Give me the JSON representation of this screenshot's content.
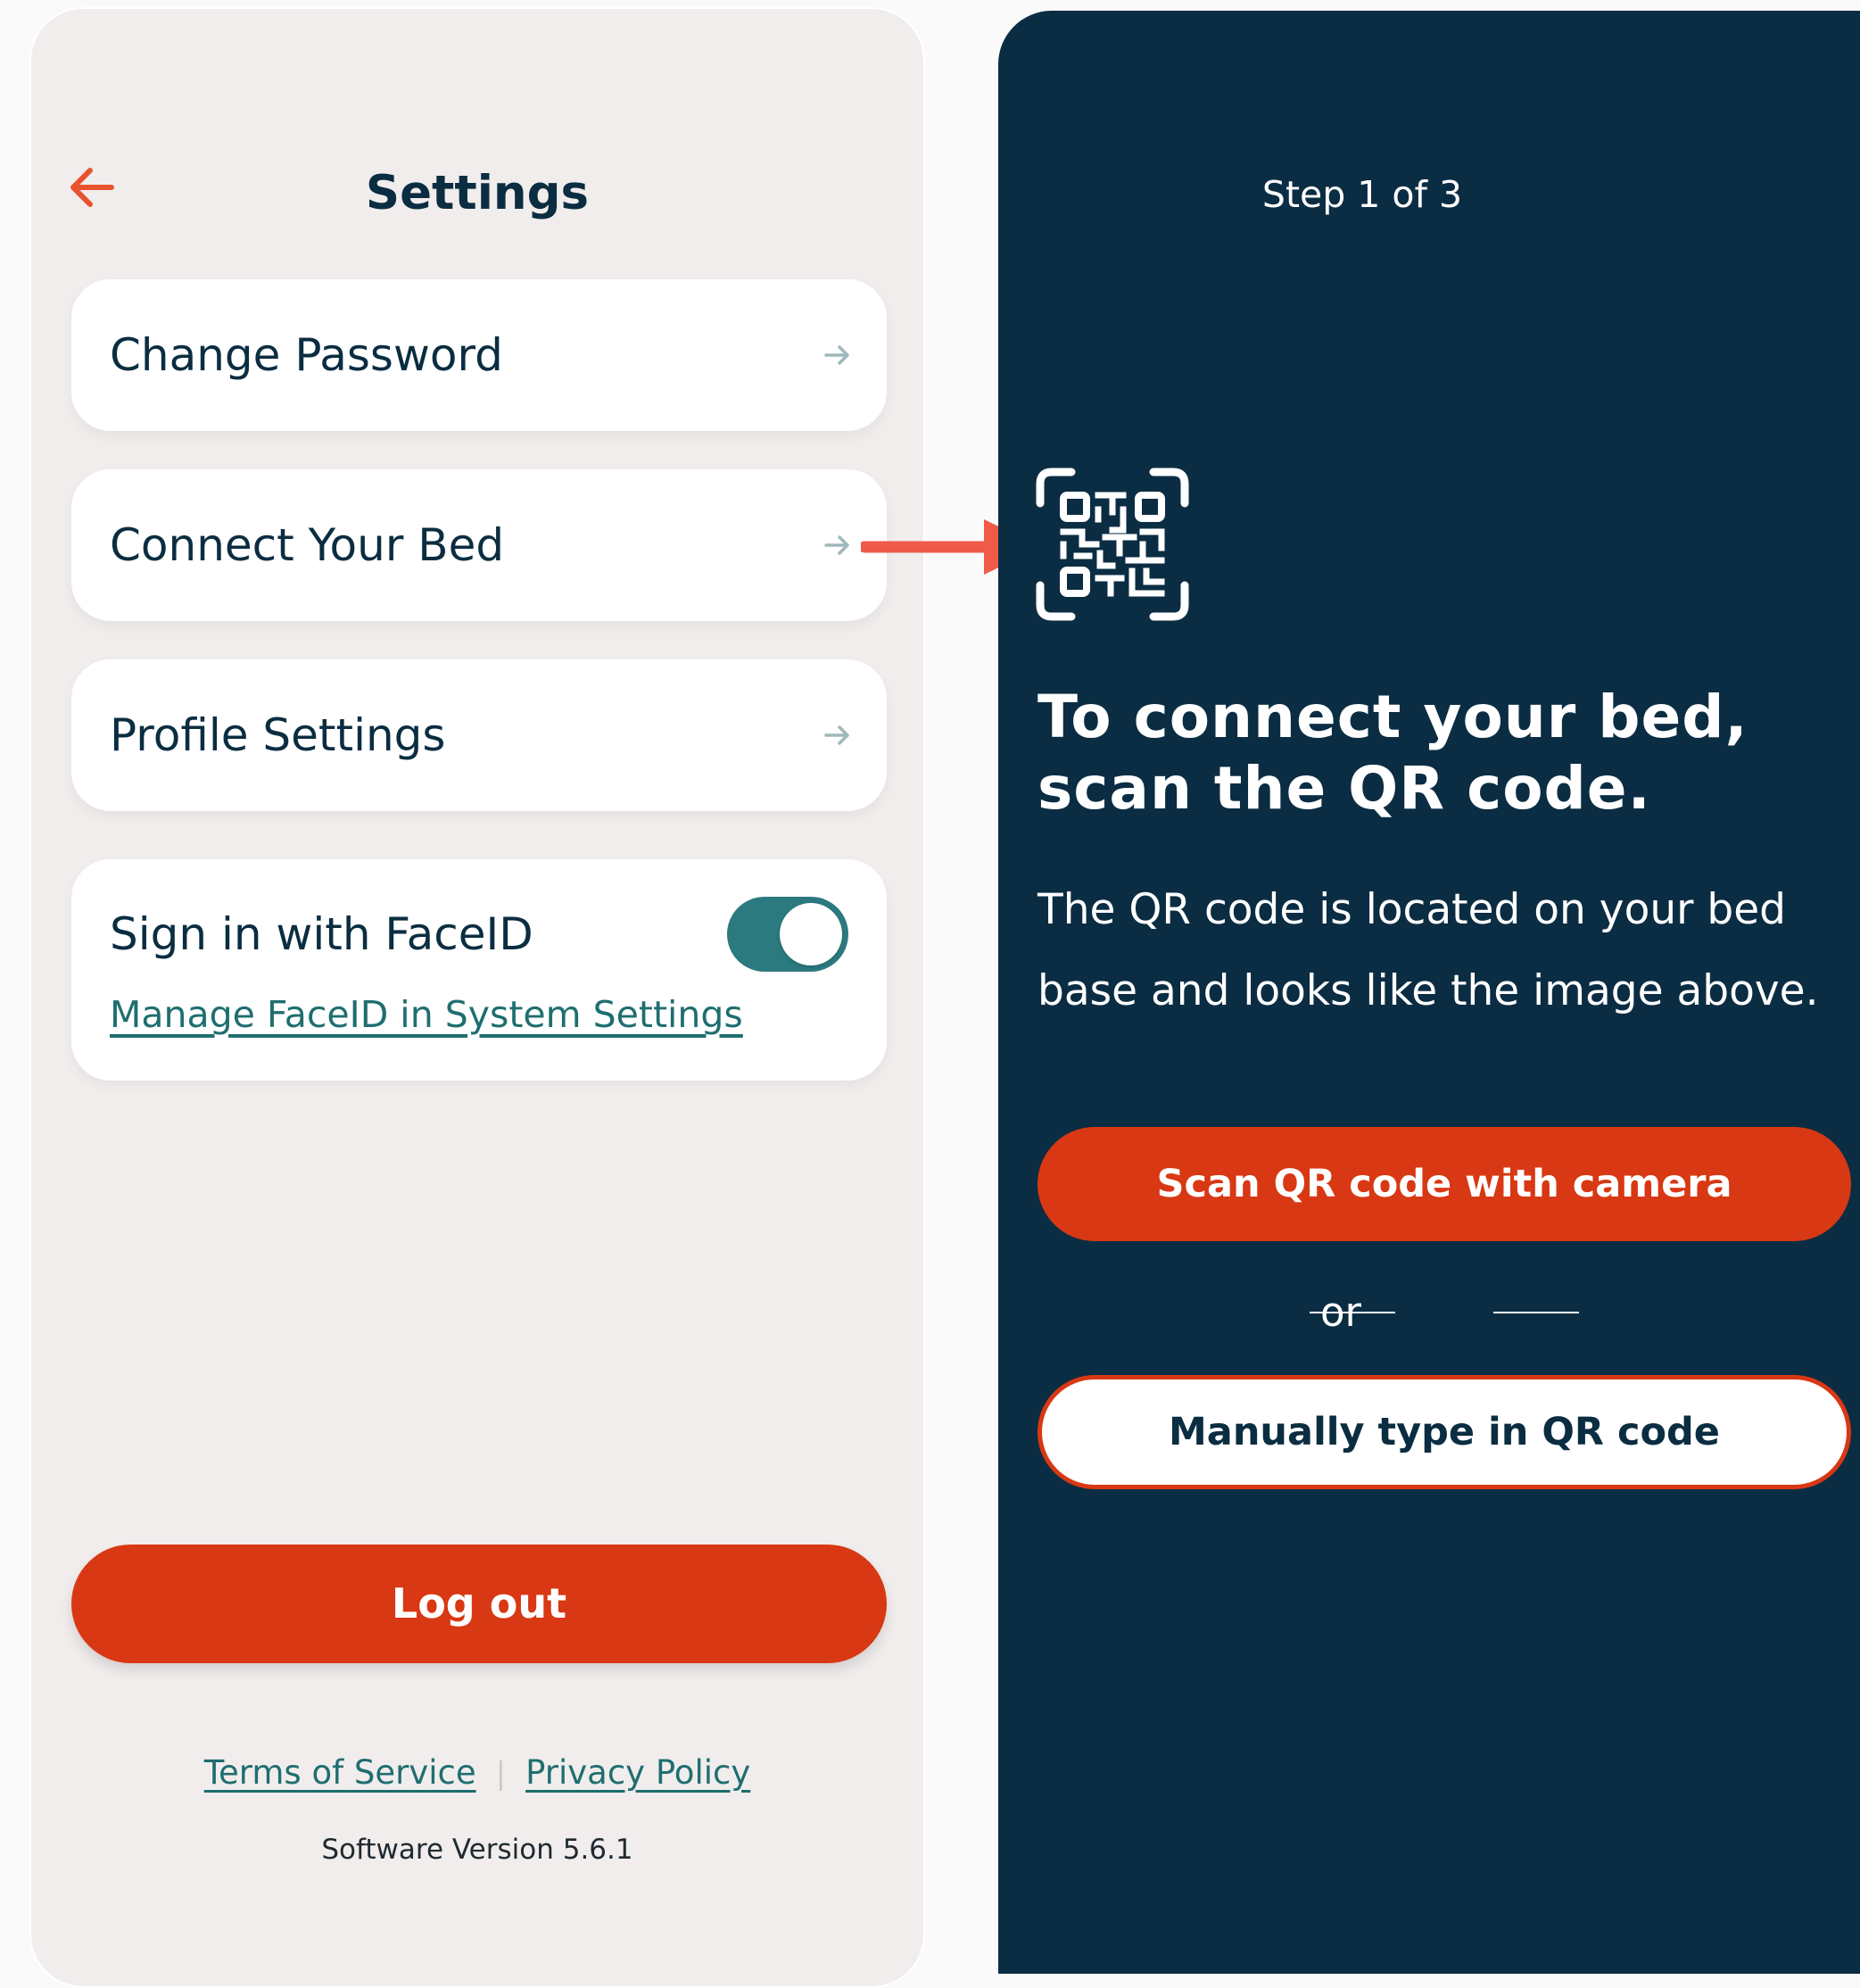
{
  "settings": {
    "title": "Settings",
    "items": [
      {
        "label": "Change Password"
      },
      {
        "label": "Connect Your Bed"
      },
      {
        "label": "Profile Settings"
      }
    ],
    "faceid": {
      "label": "Sign in with FaceID",
      "toggle_on": true,
      "manage_link": "Manage FaceID in System Settings"
    },
    "logout_label": "Log out",
    "footer": {
      "terms": "Terms of Service",
      "separator": "|",
      "privacy": "Privacy Policy",
      "version": "Software Version 5.6.1"
    }
  },
  "connect": {
    "step": "Step 1 of 3",
    "headline": "To connect your bed, scan the QR code.",
    "description": "The QR code is located on your bed base and looks like the image above.",
    "scan_button": "Scan QR code with camera",
    "or_text": "or",
    "manual_button": "Manually type in QR code"
  },
  "colors": {
    "navy": "#0b2d43",
    "accent_orange": "#d83813",
    "teal": "#2b7a80",
    "panel_bg": "#f1eded",
    "connector_arrow": "#f05a48"
  },
  "icons": {
    "back": "arrow-left-icon",
    "chevron": "arrow-right-icon",
    "qr": "qr-code-icon"
  }
}
